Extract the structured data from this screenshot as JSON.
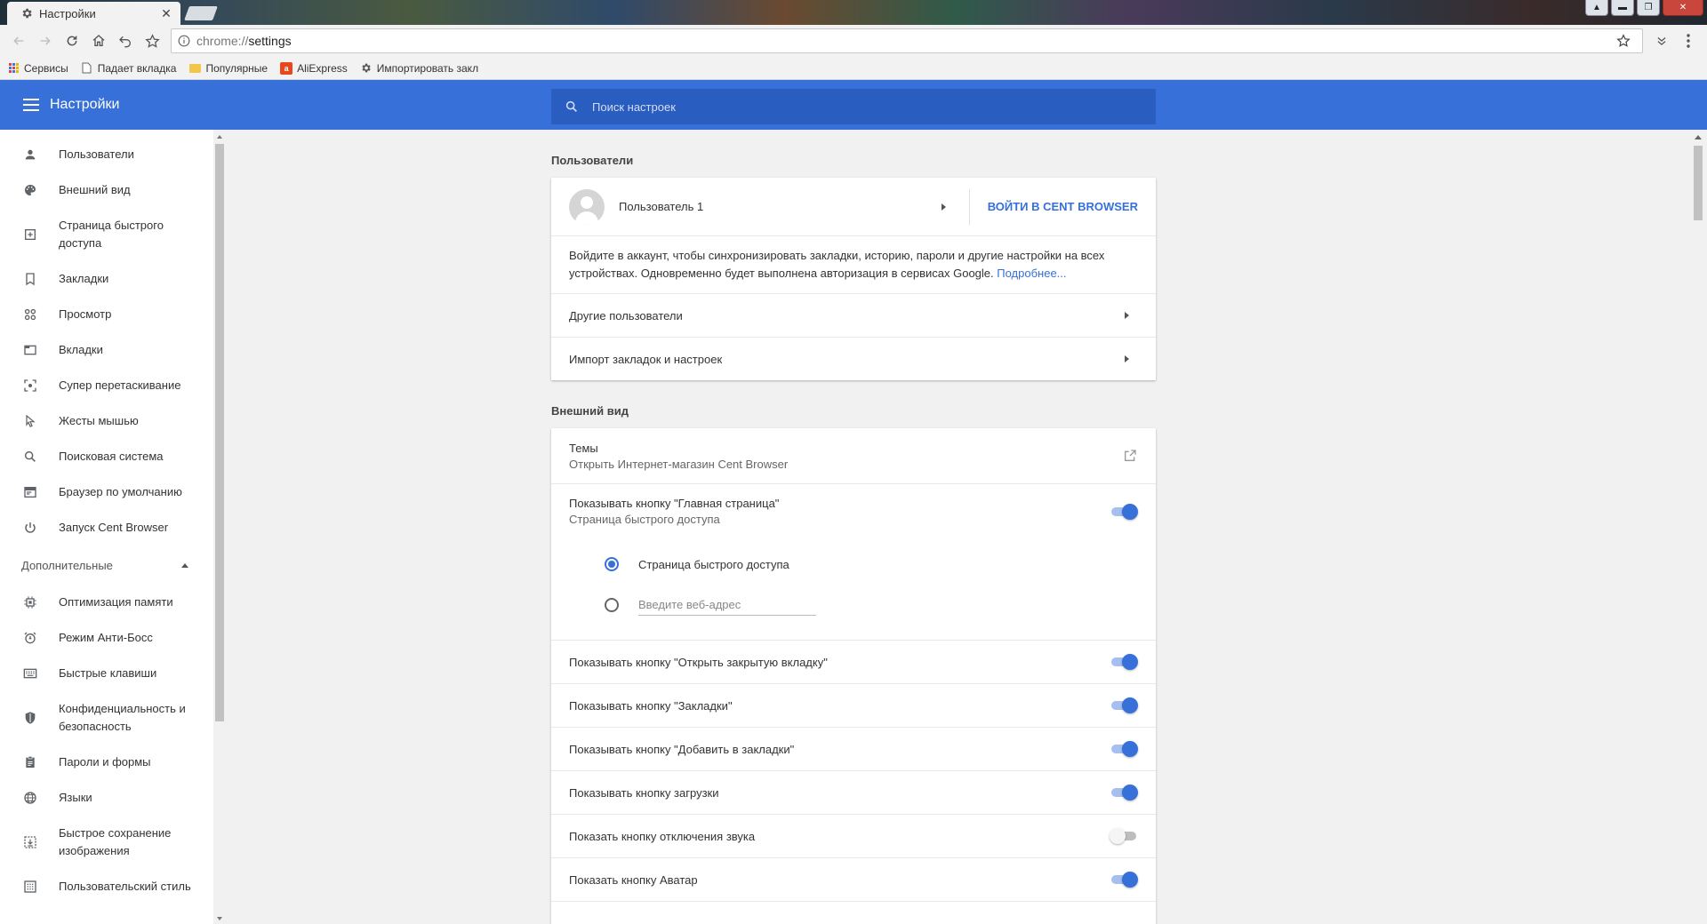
{
  "browser": {
    "tab_title": "Настройки",
    "url_scheme": "chrome://",
    "url_path": "settings",
    "bookmarks": [
      {
        "label": "Сервисы"
      },
      {
        "label": "Падает вкладка"
      },
      {
        "label": "Популярные"
      },
      {
        "label": "AliExpress"
      },
      {
        "label": "Импортировать закл"
      }
    ]
  },
  "header": {
    "title": "Настройки",
    "search_placeholder": "Поиск настроек"
  },
  "sidebar": {
    "items": [
      {
        "label": "Пользователи",
        "icon": "person-icon"
      },
      {
        "label": "Внешний вид",
        "icon": "palette-icon"
      },
      {
        "label": "Страница быстрого доступа",
        "icon": "add-page-icon"
      },
      {
        "label": "Закладки",
        "icon": "bookmark-icon"
      },
      {
        "label": "Просмотр",
        "icon": "browse-icon"
      },
      {
        "label": "Вкладки",
        "icon": "tabs-icon"
      },
      {
        "label": "Супер перетаскивание",
        "icon": "drag-icon"
      },
      {
        "label": "Жесты мышью",
        "icon": "cursor-icon"
      },
      {
        "label": "Поисковая система",
        "icon": "search-icon"
      },
      {
        "label": "Браузер по умолчанию",
        "icon": "browser-icon"
      },
      {
        "label": "Запуск Cent Browser",
        "icon": "power-icon"
      }
    ],
    "advanced_label": "Дополнительные",
    "advanced_items": [
      {
        "label": "Оптимизация памяти",
        "icon": "memory-icon"
      },
      {
        "label": "Режим Анти-Босс",
        "icon": "alarm-icon"
      },
      {
        "label": "Быстрые клавиши",
        "icon": "keyboard-icon"
      },
      {
        "label": "Конфиденциальность и безопасность",
        "icon": "shield-icon"
      },
      {
        "label": "Пароли и формы",
        "icon": "clipboard-icon"
      },
      {
        "label": "Языки",
        "icon": "globe-icon"
      },
      {
        "label": "Быстрое сохранение изображения",
        "icon": "image-save-icon"
      },
      {
        "label": "Пользовательский стиль",
        "icon": "style-icon"
      }
    ]
  },
  "users": {
    "section_title": "Пользователи",
    "user_name": "Пользователь 1",
    "signin_button": "ВОЙТИ В CENT BROWSER",
    "signin_text": "Войдите в аккаунт, чтобы синхронизировать закладки, историю, пароли и другие настройки на всех устройствах. Одновременно будет выполнена авторизация в сервисах Google.",
    "learn_more": "Подробнее...",
    "other_users": "Другие пользователи",
    "import": "Импорт закладок и настроек"
  },
  "appearance": {
    "section_title": "Внешний вид",
    "themes_title": "Темы",
    "themes_sub": "Открыть Интернет-магазин Cent Browser",
    "home_button_title": "Показывать кнопку \"Главная страница\"",
    "home_button_sub": "Страница быстрого доступа",
    "home_button_on": true,
    "radio_quick_access": "Страница быстрого доступа",
    "radio_url_placeholder": "Введите веб-адрес",
    "toggles": [
      {
        "label": "Показывать кнопку \"Открыть закрытую вкладку\"",
        "on": true
      },
      {
        "label": "Показывать кнопку \"Закладки\"",
        "on": true
      },
      {
        "label": "Показывать кнопку \"Добавить в закладки\"",
        "on": true
      },
      {
        "label": "Показывать кнопку загрузки",
        "on": true
      },
      {
        "label": "Показать кнопку отключения звука",
        "on": false
      },
      {
        "label": "Показать кнопку Аватар",
        "on": true
      }
    ]
  }
}
